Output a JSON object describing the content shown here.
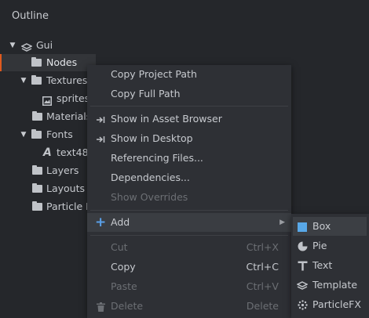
{
  "outline": {
    "title": "Outline",
    "items": [
      {
        "label": "Gui"
      },
      {
        "label": "Nodes"
      },
      {
        "label": "Textures"
      },
      {
        "label": "sprites"
      },
      {
        "label": "Materials"
      },
      {
        "label": "Fonts"
      },
      {
        "label": "text48"
      },
      {
        "label": "Layers"
      },
      {
        "label": "Layouts"
      },
      {
        "label": "Particle F"
      }
    ]
  },
  "context_menu": {
    "items": [
      {
        "label": "Copy Project Path"
      },
      {
        "label": "Copy Full Path"
      },
      {
        "label": "Show in Asset Browser"
      },
      {
        "label": "Show in Desktop"
      },
      {
        "label": "Referencing Files..."
      },
      {
        "label": "Dependencies..."
      },
      {
        "label": "Show Overrides"
      },
      {
        "label": "Add"
      },
      {
        "label": "Cut",
        "shortcut": "Ctrl+X"
      },
      {
        "label": "Copy",
        "shortcut": "Ctrl+C"
      },
      {
        "label": "Paste",
        "shortcut": "Ctrl+V"
      },
      {
        "label": "Delete",
        "shortcut": "Delete"
      }
    ]
  },
  "add_submenu": {
    "items": [
      {
        "label": "Box"
      },
      {
        "label": "Pie"
      },
      {
        "label": "Text"
      },
      {
        "label": "Template"
      },
      {
        "label": "ParticleFX"
      }
    ]
  },
  "colors": {
    "background": "#25272b",
    "menu_background": "#2e3035",
    "selection_accent": "#e05a1e",
    "add_icon": "#5aa0e8",
    "box_icon": "#58a8e8"
  }
}
